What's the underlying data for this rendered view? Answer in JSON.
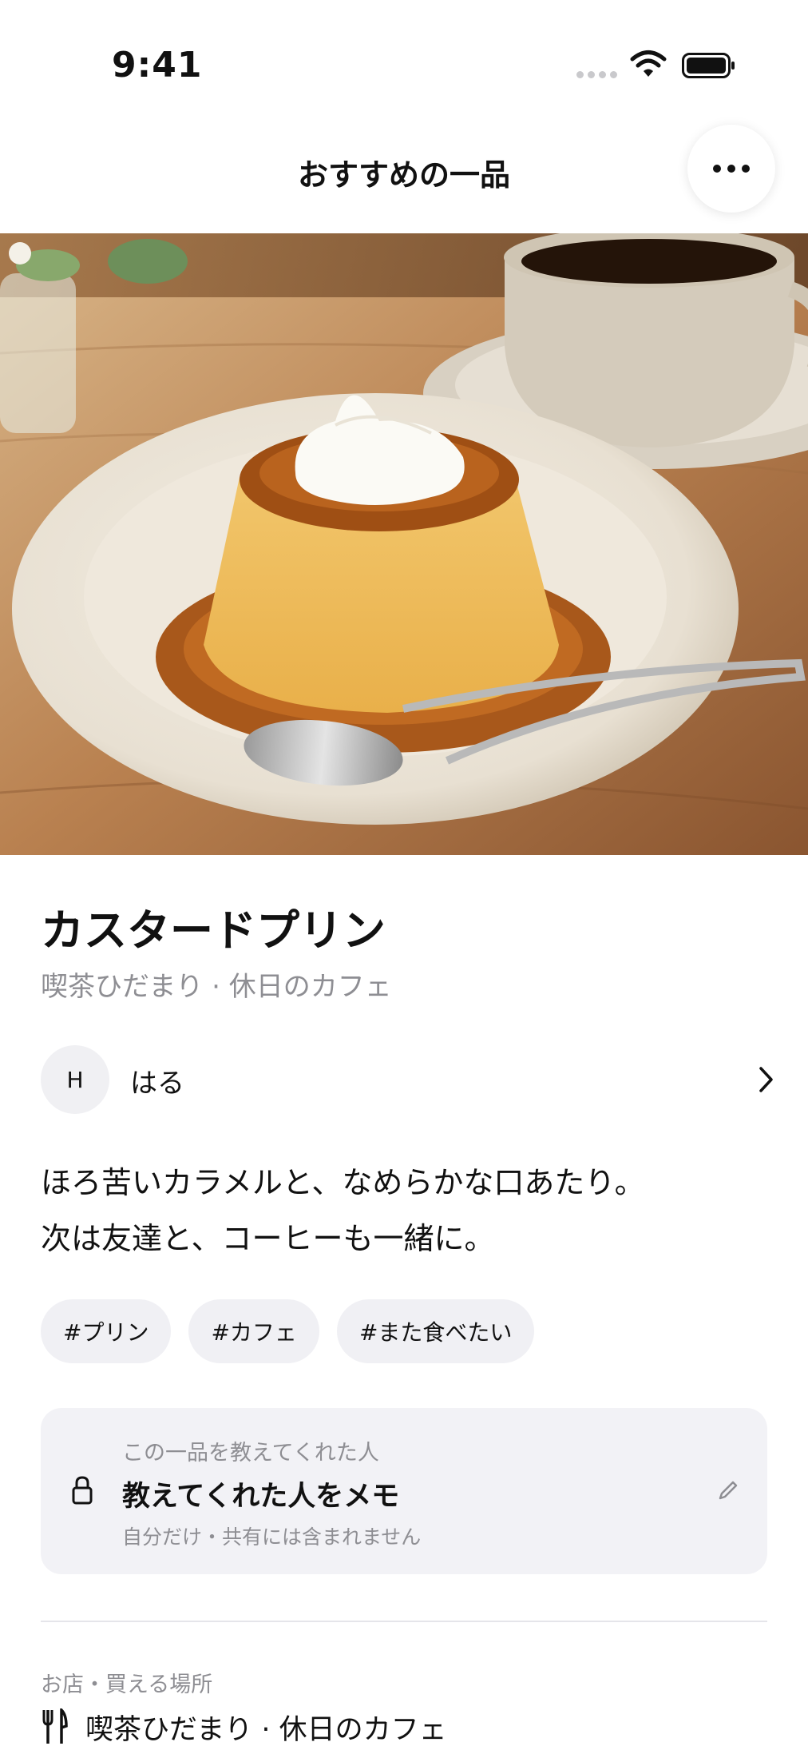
{
  "status_bar": {
    "time": "9:41"
  },
  "nav": {
    "title": "おすすめの一品"
  },
  "item": {
    "name": "カスタードプリン",
    "subtitle": "喫茶ひだまり · 休日のカフェ"
  },
  "author": {
    "initial": "H",
    "name": "はる"
  },
  "description": {
    "line1": "ほろ苦いカラメルと、なめらかな口あたり。",
    "line2": "次は友達と、コーヒーも一緒に。"
  },
  "tags": [
    "#プリン",
    "#カフェ",
    "#また食べたい"
  ],
  "memo": {
    "label": "この一品を教えてくれた人",
    "title": "教えてくれた人をメモ",
    "note": "自分だけ・共有には含まれません"
  },
  "place": {
    "label": "お店・買える場所",
    "name": "喫茶ひだまり · 休日のカフェ"
  }
}
